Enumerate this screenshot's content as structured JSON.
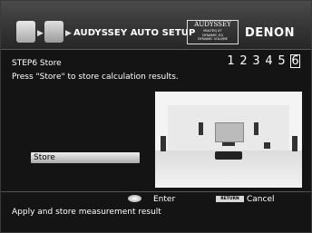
{
  "header": {
    "title": "AUDYSSEY AUTO SETUP",
    "audyssey_logo": {
      "brand": "AUDYSSEY",
      "lines": [
        "MULTEQ XT",
        "DYNAMIC EQ",
        "DYNAMIC VOLUME"
      ]
    },
    "brand": "DENON"
  },
  "step": {
    "title": "STEP6 Store",
    "numbers": [
      "1",
      "2",
      "3",
      "4",
      "5",
      "6"
    ],
    "current_index": 5
  },
  "instruction": "Press \"Store\" to store calculation results.",
  "store_button": {
    "label": "Store"
  },
  "footer": {
    "enter_label": "Enter",
    "return_key_label": "RETURN",
    "cancel_label": "Cancel",
    "status_text": "Apply and store measurement result"
  }
}
